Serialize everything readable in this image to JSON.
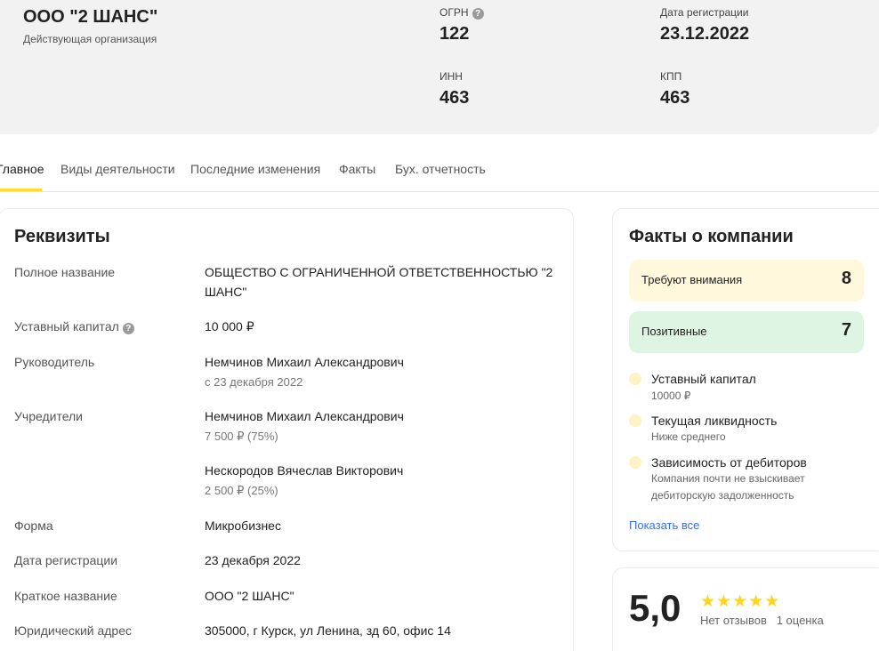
{
  "company": {
    "name": "ООО \"2 ШАНС\"",
    "status": "Действующая организация"
  },
  "header": {
    "ogrn_label": "ОГРН",
    "ogrn_value": "122",
    "inn_label": "ИНН",
    "inn_value": "463",
    "reg_date_label": "Дата регистрации",
    "reg_date_value": "23.12.2022",
    "kpp_label": "КПП",
    "kpp_value": "463",
    "help_glyph": "?"
  },
  "tabs": [
    {
      "label": "Главное",
      "active": true
    },
    {
      "label": "Виды деятельности"
    },
    {
      "label": "Последние изменения"
    },
    {
      "label": "Факты"
    },
    {
      "label": "Бух. отчетность"
    }
  ],
  "requisites": {
    "title": "Реквизиты",
    "full_name_label": "Полное название",
    "full_name_line1": "ОБЩЕСТВО С ОГРАНИЧЕННОЙ ОТВЕТСТВЕННОСТЬЮ \"2",
    "full_name_line2": "ШАНС\"",
    "capital_label": "Уставный капитал",
    "capital_value": "10 000 ₽",
    "director_label": "Руководитель",
    "director_name": "Немчинов Михаил Александрович",
    "director_since": "с 23 декабря 2022",
    "founders_label": "Учредители",
    "founders": [
      {
        "name": "Немчинов Михаил Александрович",
        "share": "7 500 ₽ (75%)"
      },
      {
        "name": "Нескородов Вячеслав Викторович",
        "share": "2 500 ₽ (25%)"
      }
    ],
    "form_label": "Форма",
    "form_value": "Микробизнес",
    "reg_date_label": "Дата регистрации",
    "reg_date_value": "23 декабря 2022",
    "short_name_label": "Краткое название",
    "short_name_value": "ООО \"2 ШАНС\"",
    "address_label": "Юридический адрес",
    "address_value": "305000, г Курск, ул Ленина, зд 60, офис 14"
  },
  "facts": {
    "title": "Факты о компании",
    "attention_label": "Требуют внимания",
    "attention_count": "8",
    "positive_label": "Позитивные",
    "positive_count": "7",
    "items": [
      {
        "title": "Уставный капитал",
        "sub": "10000 ₽"
      },
      {
        "title": "Текущая ликвидность",
        "sub": "Ниже среднего"
      },
      {
        "title": "Зависимость от дебиторов",
        "sub_line1": "Компания почти не взыскивает",
        "sub_line2": "дебиторскую задолженность"
      }
    ],
    "show_all": "Показать все",
    "colors": {
      "attention_bg": "#fff8dc",
      "positive_bg": "#dff5e3",
      "dot": "#fdf3c4"
    }
  },
  "rating": {
    "value": "5,0",
    "stars": "★★★★★",
    "reviews": "Нет отзывов",
    "ratings_count": "1 оценка"
  }
}
